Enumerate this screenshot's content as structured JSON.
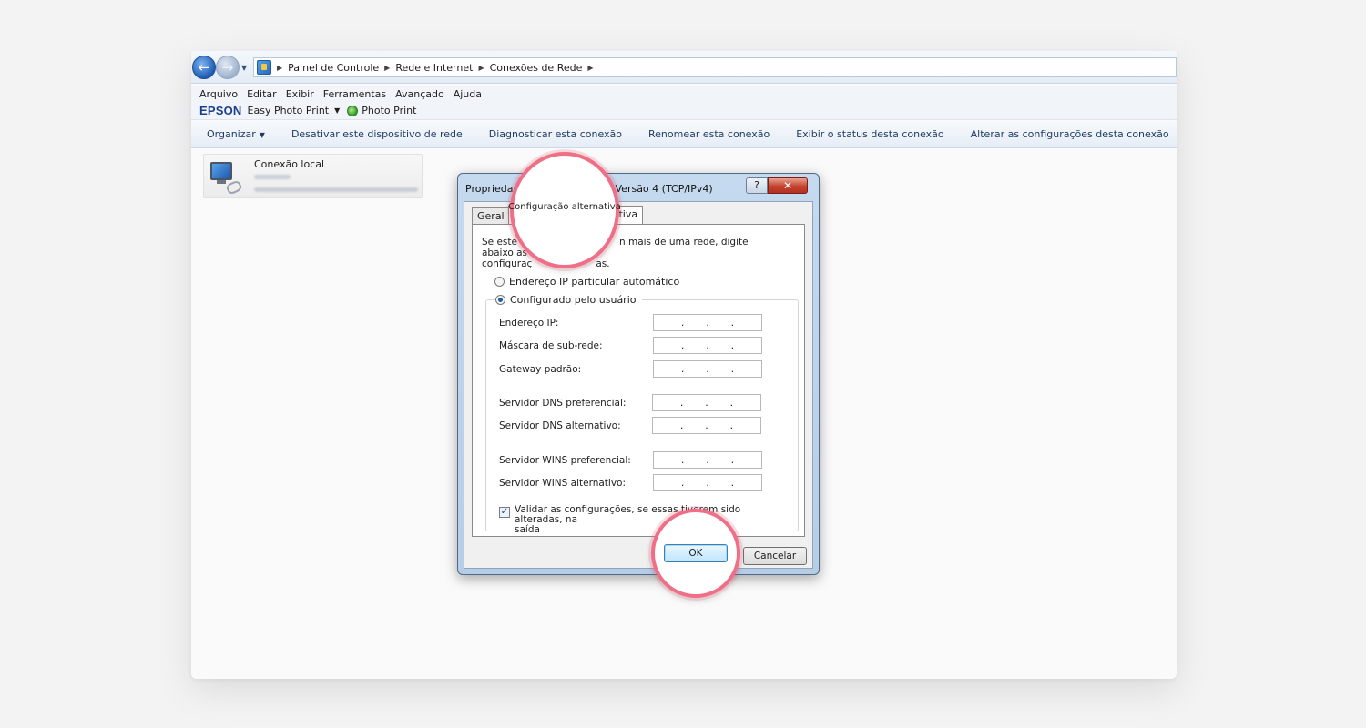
{
  "explorer": {
    "breadcrumbs": [
      "Painel de Controle",
      "Rede e Internet",
      "Conexões de Rede"
    ],
    "menu": [
      "Arquivo",
      "Editar",
      "Exibir",
      "Ferramentas",
      "Avançado",
      "Ajuda"
    ],
    "epson": {
      "logo": "EPSON",
      "easy_photo_print": "Easy Photo Print",
      "photo_print": "Photo Print"
    },
    "commands": {
      "organize": "Organizar",
      "disable": "Desativar este dispositivo de rede",
      "diagnose": "Diagnosticar esta conexão",
      "rename": "Renomear esta conexão",
      "status": "Exibir o status desta conexão",
      "change": "Alterar as configurações desta conexão"
    },
    "connection": {
      "title": "Conexão local"
    }
  },
  "dialog": {
    "title_left": "Propriedad",
    "title_right": "Versão 4 (TCP/IPv4)",
    "help": "?",
    "close": "✕",
    "tabs": {
      "general": "Geral",
      "alternate": "Configuração alternativa"
    },
    "description_left_1": "Se este",
    "description_right_1": "n mais de uma rede, digite abaixo as",
    "description_left_2": "configuraç",
    "description_right_2": "as.",
    "radio_auto": "Endereço IP particular automático",
    "radio_user": "Configurado pelo usuário",
    "fields": {
      "ip": "Endereço IP:",
      "mask": "Máscara de sub-rede:",
      "gateway": "Gateway padrão:",
      "dns_pref": "Servidor DNS preferencial:",
      "dns_alt": "Servidor DNS alternativo:",
      "wins_pref": "Servidor WINS preferencial:",
      "wins_alt": "Servidor WINS alternativo:"
    },
    "validate_line1": "Validar as configurações, se essas tiverem sido alteradas, na",
    "validate_line2": "saída",
    "ok": "OK",
    "cancel": "Cancelar"
  },
  "highlights": {
    "tab_label": "Configuração alternativa",
    "ok_label": "OK"
  }
}
